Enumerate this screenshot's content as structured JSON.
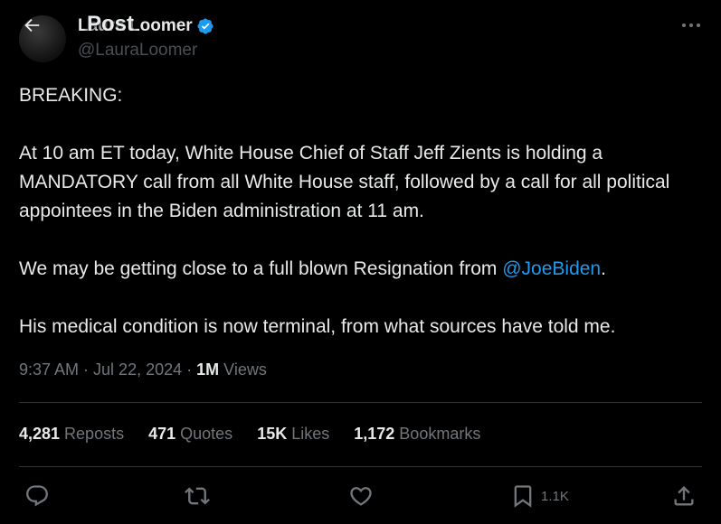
{
  "header": {
    "title": "Post",
    "display_name": "Laura Loomer",
    "handle": "@LauraLoomer"
  },
  "post": {
    "line_breaking": "BREAKING:",
    "para2": "At 10 am ET today, White House Chief of Staff Jeff Zients is holding a MANDATORY call from all White House staff, followed by a call for all political appointees in the Biden administration at 11 am.",
    "para3_before": "We may be getting close to a full blown Resignation from ",
    "para3_mention": "@JoeBiden",
    "para3_after": ".",
    "para4": "His medical condition is now terminal, from what sources have told me."
  },
  "meta": {
    "time": "9:37 AM",
    "separator1": " · ",
    "date": "Jul 22, 2024",
    "separator2": " · ",
    "views_count": "1M",
    "views_label": " Views"
  },
  "stats": {
    "reposts_count": "4,281",
    "reposts_label": " Reposts",
    "quotes_count": "471",
    "quotes_label": " Quotes",
    "likes_count": "15K",
    "likes_label": " Likes",
    "bookmarks_count": "1,172",
    "bookmarks_label": " Bookmarks"
  },
  "actions": {
    "bookmark_count": "1.1K"
  },
  "colors": {
    "background": "#000000",
    "text": "#e7e9ea",
    "muted": "#71767b",
    "accent": "#1d9bf0",
    "divider": "#2f3336"
  },
  "icons": [
    "back-arrow-icon",
    "verified-badge-icon",
    "more-icon",
    "reply-icon",
    "repost-icon",
    "like-icon",
    "bookmark-icon",
    "share-icon"
  ]
}
